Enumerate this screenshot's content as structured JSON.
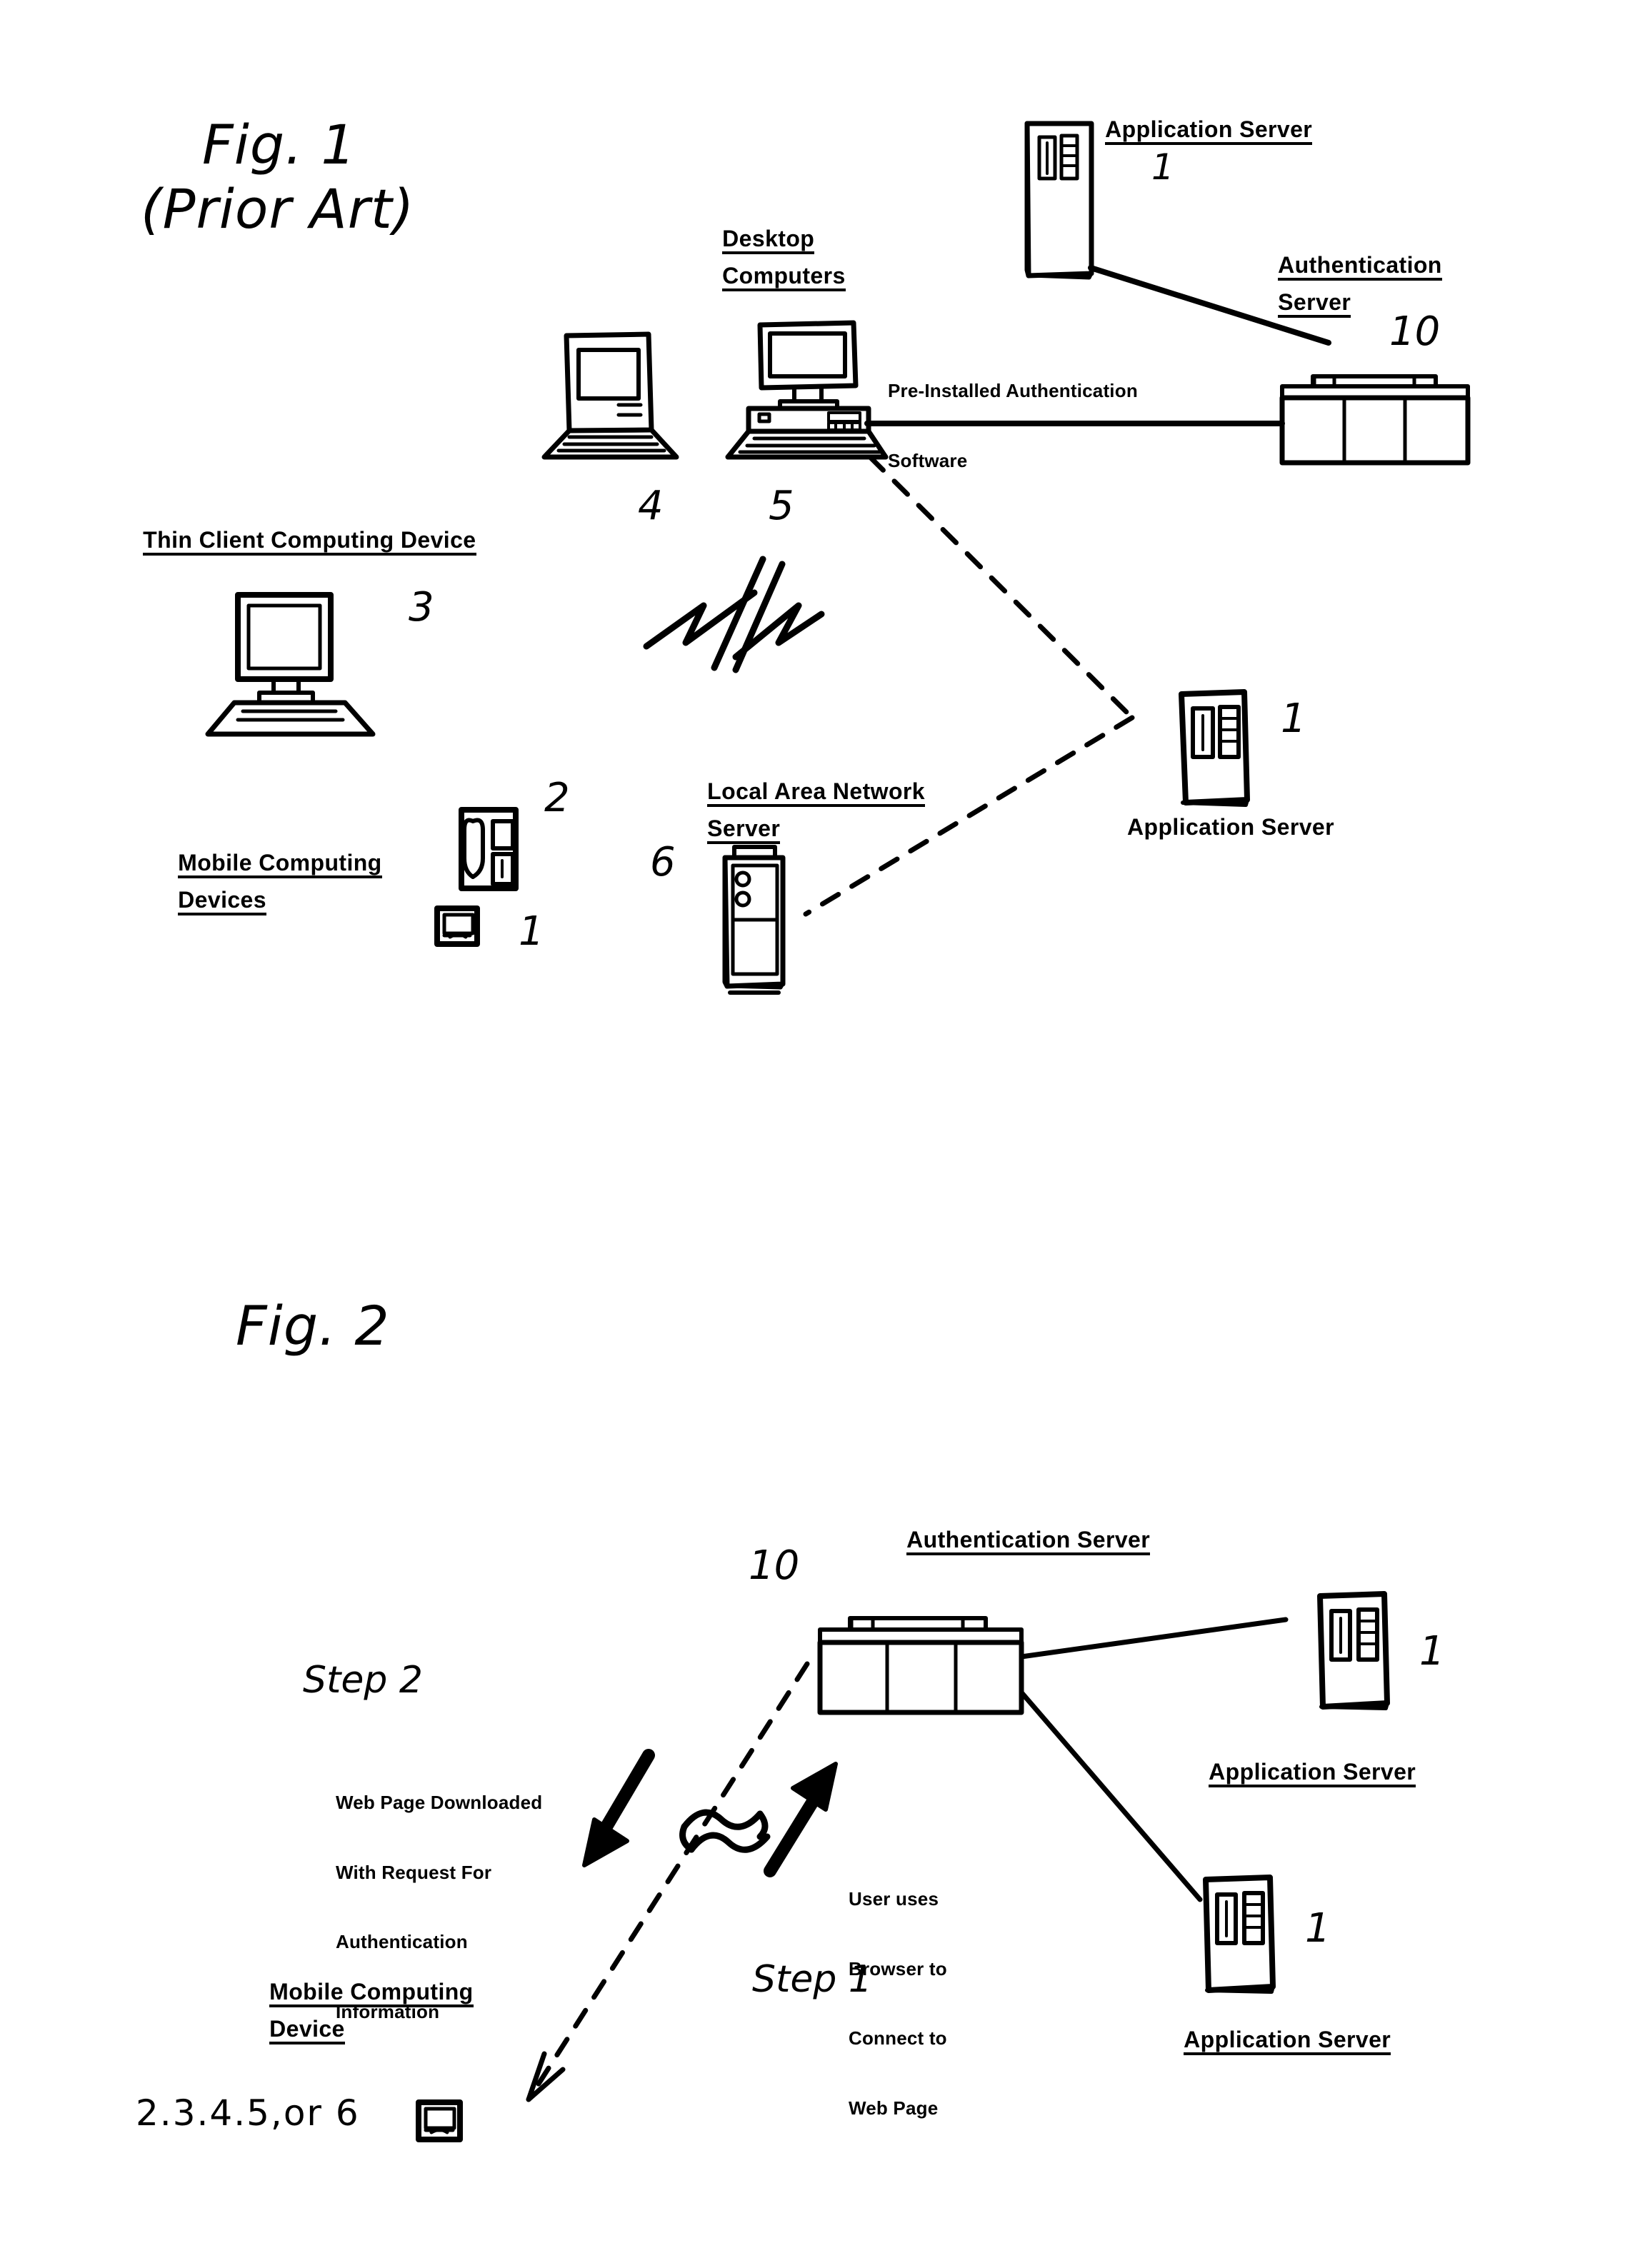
{
  "document": {
    "kind": "patent-drawing-sheet",
    "background_color": "#ffffff",
    "ink_color": "#000000"
  },
  "figure1": {
    "title_line1": "Fig. 1",
    "title_line2": "(Prior Art)",
    "labels": {
      "desktop_computers_line1": "Desktop",
      "desktop_computers_line2": "Computers",
      "application_server_top": "Application Server",
      "authentication_server_line1": "Authentication",
      "authentication_server_line2": "Server",
      "pre_installed_line1": "Pre-Installed Authentication",
      "pre_installed_line2": "Software",
      "thin_client": "Thin Client Computing Device",
      "mobile_devices_line1": "Mobile Computing",
      "mobile_devices_line2": "Devices",
      "lan_server_line1": "Local Area Network",
      "lan_server_line2": "Server",
      "application_server_right": "Application Server"
    },
    "reference_numerals": {
      "app_server_top": "1",
      "auth_server": "10",
      "laptop": "4",
      "desktop": "5",
      "thin_client": "3",
      "phone": "2",
      "pda": "1",
      "lan_server": "6",
      "app_server_right": "1"
    },
    "icons": [
      "laptop-icon",
      "desktop-computer-icon",
      "thin-client-icon",
      "mobile-phone-icon",
      "pda-icon",
      "lan-server-tower-icon",
      "application-server-tower-icon",
      "authentication-server-rack-icon",
      "wireless-signal-icon"
    ]
  },
  "figure2": {
    "title": "Fig. 2",
    "labels": {
      "authentication_server": "Authentication Server",
      "application_server_upper": "Application Server",
      "application_server_lower": "Application Server",
      "mobile_device_line1": "Mobile Computing",
      "mobile_device_line2": "Device"
    },
    "steps": {
      "step2_label": "Step 2",
      "step2_note_line1": "Web Page Downloaded",
      "step2_note_line2": "With Request For",
      "step2_note_line3": "Authentication",
      "step2_note_line4": "Information",
      "step1_label": "Step 1",
      "step1_note_line1": "User uses",
      "step1_note_line2": "Browser to",
      "step1_note_line3": "Connect to",
      "step1_note_line4": "Web Page"
    },
    "reference_numerals": {
      "auth_server": "10",
      "app_server_upper": "1",
      "app_server_lower": "1",
      "mobile_device_list": "2.3.4.5,or 6"
    },
    "icons": [
      "authentication-server-rack-icon",
      "application-server-tower-icon",
      "pda-icon",
      "down-arrow-icon",
      "up-arrow-icon",
      "wireless-squiggle-icon"
    ]
  }
}
